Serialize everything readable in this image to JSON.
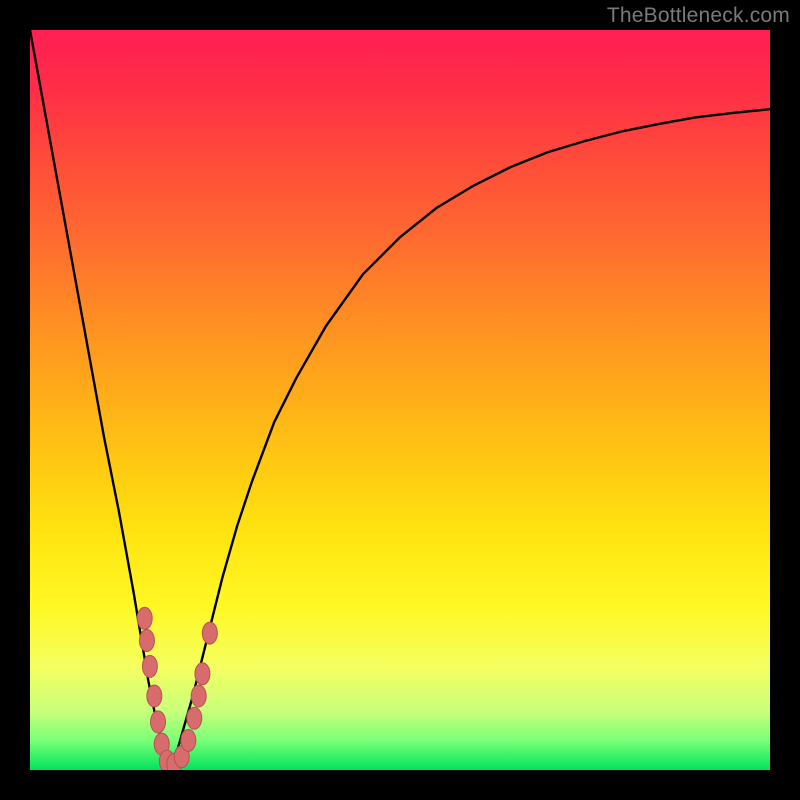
{
  "watermark": "TheBottleneck.com",
  "colors": {
    "bg": "#000000",
    "curve": "#000000",
    "marker_fill": "#d86b6b",
    "marker_stroke": "#b25454"
  },
  "chart_data": {
    "type": "line",
    "title": "",
    "xlabel": "",
    "ylabel": "",
    "xlim": [
      0,
      100
    ],
    "ylim": [
      0,
      100
    ],
    "note": "V-shaped bottleneck curve with minimum near x≈19; axes have no visible tick labels, values estimated from curve shape.",
    "series": [
      {
        "name": "bottleneck-curve",
        "x": [
          0,
          2,
          4,
          6,
          8,
          10,
          12,
          14,
          15,
          16,
          17,
          18,
          19,
          20,
          22,
          24,
          26,
          28,
          30,
          33,
          36,
          40,
          45,
          50,
          55,
          60,
          65,
          70,
          75,
          80,
          85,
          90,
          95,
          100
        ],
        "y": [
          100,
          89,
          78,
          67,
          56,
          45,
          35,
          24,
          18,
          12,
          7,
          3,
          0,
          3,
          10,
          18,
          26,
          33,
          39,
          47,
          53,
          60,
          67,
          72,
          76,
          79,
          81.5,
          83.5,
          85,
          86.3,
          87.3,
          88.2,
          88.8,
          89.3
        ]
      }
    ],
    "markers": {
      "name": "sample-points",
      "points": [
        {
          "x": 15.5,
          "y": 20.5
        },
        {
          "x": 15.8,
          "y": 17.5
        },
        {
          "x": 16.2,
          "y": 14.0
        },
        {
          "x": 16.8,
          "y": 10.0
        },
        {
          "x": 17.3,
          "y": 6.5
        },
        {
          "x": 17.8,
          "y": 3.5
        },
        {
          "x": 18.5,
          "y": 1.2
        },
        {
          "x": 19.5,
          "y": 0.8
        },
        {
          "x": 20.5,
          "y": 1.8
        },
        {
          "x": 21.4,
          "y": 4.0
        },
        {
          "x": 22.2,
          "y": 7.0
        },
        {
          "x": 22.8,
          "y": 10.0
        },
        {
          "x": 23.3,
          "y": 13.0
        },
        {
          "x": 24.3,
          "y": 18.5
        }
      ]
    }
  }
}
